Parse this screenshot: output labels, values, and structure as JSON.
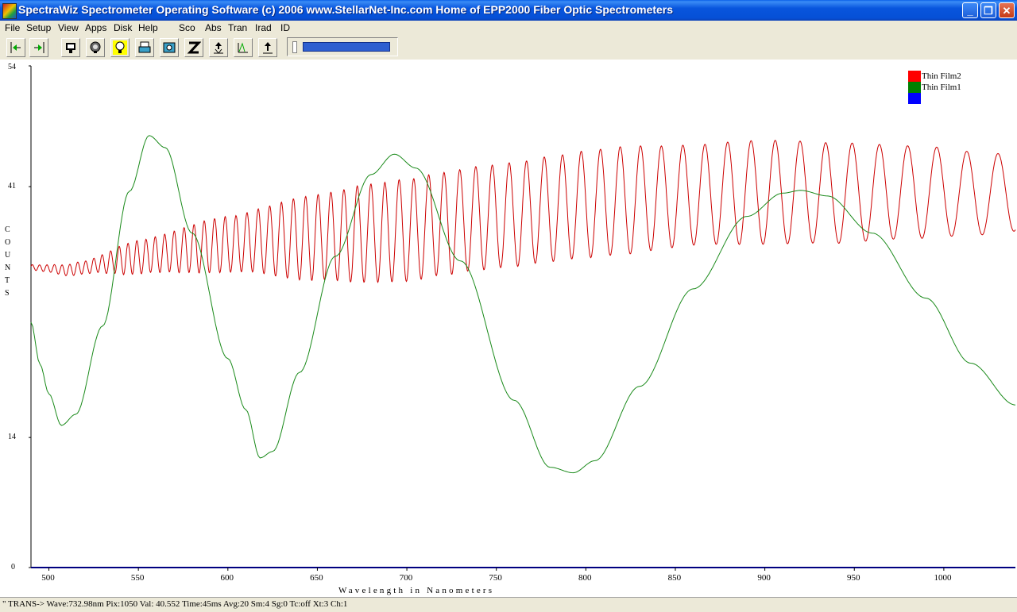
{
  "window": {
    "title": "SpectraWiz  Spectrometer Operating Software (c) 2006  www.StellarNet-Inc.com  Home of EPP2000 Fiber Optic Spectrometers",
    "minimize": "_",
    "maximize": "❐",
    "close": "✕"
  },
  "menu": [
    "File",
    "Setup",
    "View",
    "Apps",
    "Disk",
    "Help",
    "Sco",
    "Abs",
    "Tran",
    "Irad",
    "ID"
  ],
  "toolbar": {
    "buttons": [
      "prev-icon",
      "next-icon",
      "monitor-icon",
      "eye-icon",
      "bulb-icon",
      "printer-icon",
      "camera-icon",
      "z-icon",
      "upload-icon",
      "peak-icon",
      "export-icon"
    ],
    "progress": 1.0
  },
  "chart_data": {
    "type": "line",
    "xlabel": "Wavelength in Nanometers",
    "ylabel": "COUNTS",
    "xlim": [
      490,
      1040
    ],
    "ylim": [
      0,
      54
    ],
    "x_ticks": [
      "500",
      "550",
      "600",
      "650",
      "700",
      "750",
      "800",
      "850",
      "900",
      "950",
      "1000"
    ],
    "y_ticks": [
      "54",
      "41",
      "14",
      "0"
    ],
    "legend_position": "top-right",
    "legend": [
      {
        "name": "Thin Film2",
        "color": "#ff0000"
      },
      {
        "name": "Thin Film1",
        "color": "#008000"
      },
      {
        "name": "",
        "color": "#0000ff"
      }
    ],
    "series": [
      {
        "name": "Thin Film2",
        "color": "#cc0000",
        "points": [
          [
            490,
            32.3
          ],
          [
            500,
            32.2
          ],
          [
            510,
            32.0
          ],
          [
            520,
            32.3
          ],
          [
            530,
            32.7
          ],
          [
            540,
            33.1
          ],
          [
            550,
            33.4
          ],
          [
            560,
            33.7
          ],
          [
            570,
            34.0
          ],
          [
            580,
            34.3
          ],
          [
            590,
            34.6
          ],
          [
            600,
            34.8
          ],
          [
            620,
            35.2
          ],
          [
            640,
            35.4
          ],
          [
            660,
            35.7
          ],
          [
            680,
            36.0
          ],
          [
            700,
            36.3
          ],
          [
            720,
            37.0
          ],
          [
            740,
            37.6
          ],
          [
            760,
            38.0
          ],
          [
            780,
            38.6
          ],
          [
            800,
            39.1
          ],
          [
            820,
            39.5
          ],
          [
            840,
            39.8
          ],
          [
            860,
            40.1
          ],
          [
            880,
            40.3
          ],
          [
            900,
            40.4
          ],
          [
            920,
            40.4
          ],
          [
            940,
            40.3
          ],
          [
            960,
            40.4
          ],
          [
            980,
            40.4
          ],
          [
            1000,
            40.4
          ],
          [
            1020,
            40.2
          ],
          [
            1040,
            40.4
          ]
        ],
        "amplitude": [
          [
            490,
            0.3
          ],
          [
            520,
            0.7
          ],
          [
            550,
            1.8
          ],
          [
            600,
            3.0
          ],
          [
            650,
            4.6
          ],
          [
            680,
            5.3
          ],
          [
            700,
            5.5
          ],
          [
            760,
            5.6
          ],
          [
            820,
            5.8
          ],
          [
            860,
            5.4
          ],
          [
            900,
            5.6
          ],
          [
            940,
            5.4
          ],
          [
            980,
            5.0
          ],
          [
            1040,
            4.2
          ]
        ]
      },
      {
        "name": "Thin Film1",
        "color": "#1a8a1a",
        "points": [
          [
            490,
            26.4
          ],
          [
            495,
            21.9
          ],
          [
            500,
            18.7
          ],
          [
            507,
            15.3
          ],
          [
            515,
            16.5
          ],
          [
            530,
            26.0
          ],
          [
            545,
            40.5
          ],
          [
            556,
            46.5
          ],
          [
            565,
            45.2
          ],
          [
            580,
            36.0
          ],
          [
            600,
            22.5
          ],
          [
            610,
            17.0
          ],
          [
            618,
            11.8
          ],
          [
            625,
            12.5
          ],
          [
            640,
            21.0
          ],
          [
            660,
            33.5
          ],
          [
            680,
            42.3
          ],
          [
            693,
            44.5
          ],
          [
            705,
            43.0
          ],
          [
            730,
            33.0
          ],
          [
            760,
            18.0
          ],
          [
            780,
            10.8
          ],
          [
            793,
            10.2
          ],
          [
            805,
            11.5
          ],
          [
            830,
            19.5
          ],
          [
            860,
            30.0
          ],
          [
            890,
            37.8
          ],
          [
            910,
            40.3
          ],
          [
            920,
            40.6
          ],
          [
            935,
            40.0
          ],
          [
            960,
            36.0
          ],
          [
            990,
            29.0
          ],
          [
            1015,
            22.0
          ],
          [
            1040,
            17.5
          ]
        ]
      }
    ]
  },
  "status": "\" TRANS->  Wave:732.98nm  Pix:1050  Val: 40.552  Time:45ms  Avg:20  Sm:4  Sg:0  Tc:off  Xt:3  Ch:1"
}
